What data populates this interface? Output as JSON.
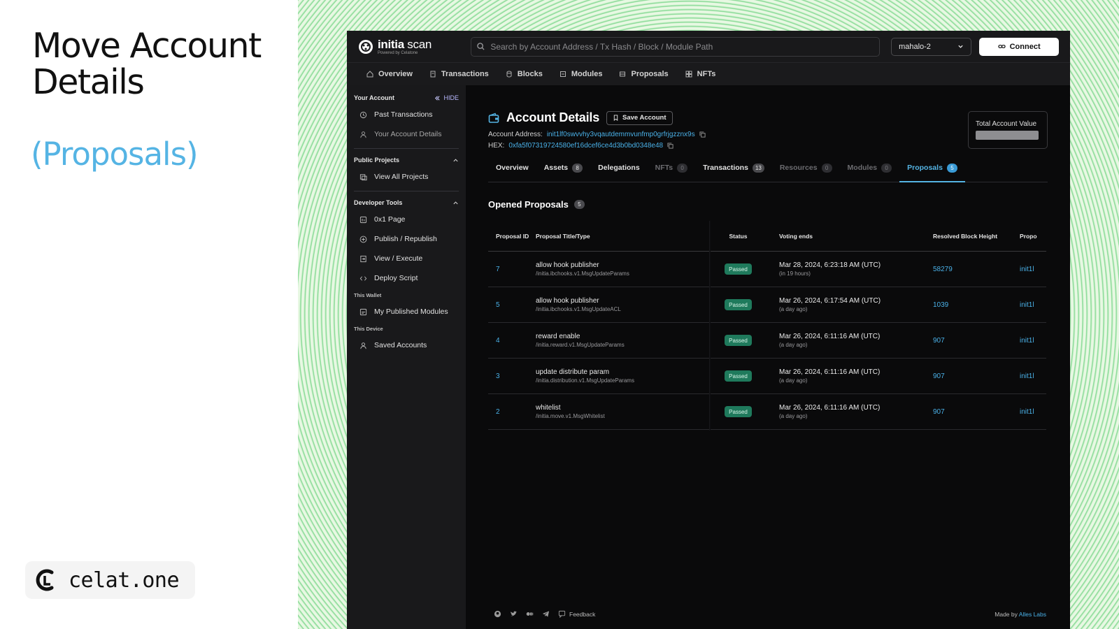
{
  "slide": {
    "title_line1": "Move Account",
    "title_line2": "Details",
    "subtitle": "(Proposals)",
    "brand": "celat.one"
  },
  "app": {
    "logo_name_bold": "initia",
    "logo_name_rest": " scan",
    "logo_sub": "Powered by Celatone",
    "search_placeholder": "Search by Account Address / Tx Hash / Block / Module Path",
    "network": "mahalo-2",
    "connect_label": "Connect",
    "nav": [
      "Overview",
      "Transactions",
      "Blocks",
      "Modules",
      "Proposals",
      "NFTs"
    ]
  },
  "sidebar": {
    "your_account": "Your Account",
    "hide": "HIDE",
    "past_transactions": "Past Transactions",
    "your_account_details": "Your Account Details",
    "public_projects": "Public Projects",
    "view_all_projects": "View All Projects",
    "developer_tools": "Developer Tools",
    "page_0x1": "0x1 Page",
    "publish": "Publish / Republish",
    "view_execute": "View / Execute",
    "deploy_script": "Deploy Script",
    "this_wallet": "This Wallet",
    "my_published_modules": "My Published Modules",
    "this_device": "This Device",
    "saved_accounts": "Saved Accounts"
  },
  "account": {
    "title": "Account Details",
    "save_label": "Save Account",
    "address_label": "Account Address:",
    "address": "init1lf0swvvhy3vqautdemmvunfmp0grfrjgzznx9s",
    "hex_label": "HEX:",
    "hex": "0xfa5f07319724580ef16dcef6ce4d3b0bd0348e48",
    "total_value_label": "Total Account Value"
  },
  "tabs": [
    {
      "label": "Overview",
      "count": ""
    },
    {
      "label": "Assets",
      "count": "8"
    },
    {
      "label": "Delegations",
      "count": ""
    },
    {
      "label": "NFTs",
      "count": "0"
    },
    {
      "label": "Transactions",
      "count": "13"
    },
    {
      "label": "Resources",
      "count": "0"
    },
    {
      "label": "Modules",
      "count": "0"
    },
    {
      "label": "Proposals",
      "count": "5"
    }
  ],
  "proposals": {
    "title": "Opened Proposals",
    "count": "5",
    "headers": {
      "id": "Proposal ID",
      "title": "Proposal Title/Type",
      "status": "Status",
      "voting": "Voting ends",
      "block": "Resolved Block Height",
      "proposer": "Propo"
    },
    "rows": [
      {
        "id": "7",
        "title": "allow hook publisher",
        "type": "/initia.ibchooks.v1.MsgUpdateParams",
        "status": "Passed",
        "voting": "Mar 28, 2024, 6:23:18 AM (UTC)",
        "relative": "(in 19 hours)",
        "block": "58279",
        "proposer": "init1l"
      },
      {
        "id": "5",
        "title": "allow hook publisher",
        "type": "/initia.ibchooks.v1.MsgUpdateACL",
        "status": "Passed",
        "voting": "Mar 26, 2024, 6:17:54 AM (UTC)",
        "relative": "(a day ago)",
        "block": "1039",
        "proposer": "init1l"
      },
      {
        "id": "4",
        "title": "reward enable",
        "type": "/initia.reward.v1.MsgUpdateParams",
        "status": "Passed",
        "voting": "Mar 26, 2024, 6:11:16 AM (UTC)",
        "relative": "(a day ago)",
        "block": "907",
        "proposer": "init1l"
      },
      {
        "id": "3",
        "title": "update distribute param",
        "type": "/initia.distribution.v1.MsgUpdateParams",
        "status": "Passed",
        "voting": "Mar 26, 2024, 6:11:16 AM (UTC)",
        "relative": "(a day ago)",
        "block": "907",
        "proposer": "init1l"
      },
      {
        "id": "2",
        "title": "whitelist",
        "type": "/initia.move.v1.MsgWhitelist",
        "status": "Passed",
        "voting": "Mar 26, 2024, 6:11:16 AM (UTC)",
        "relative": "(a day ago)",
        "block": "907",
        "proposer": "init1l"
      }
    ]
  },
  "footer": {
    "feedback": "Feedback",
    "made_by": "Made by",
    "made_by_link": "Alles Labs"
  },
  "colors": {
    "accent": "#55b4e4",
    "passed": "#1f7a5c",
    "background": "#0a0a0b"
  }
}
